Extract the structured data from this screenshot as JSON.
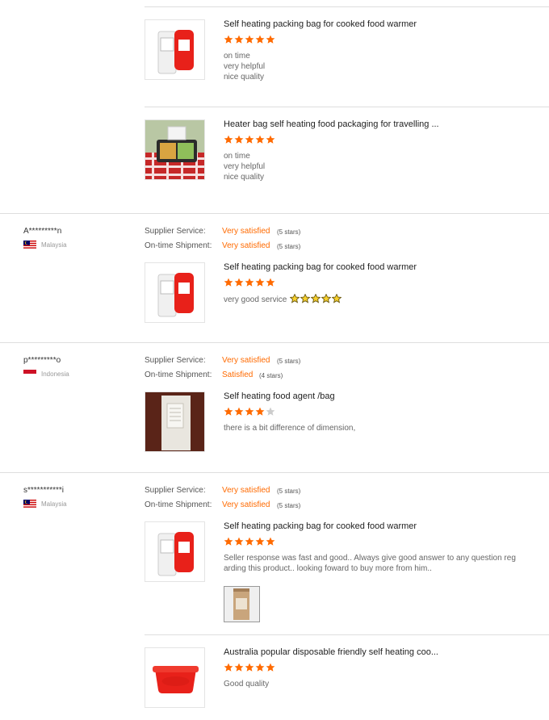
{
  "colors": {
    "star_on": "#ff6a00",
    "star_off": "#cccccc",
    "satisfied": "#ff6a00"
  },
  "labels": {
    "supplier_service": "Supplier Service:",
    "ontime_shipment": "On-time Shipment:"
  },
  "reviews_top": [
    {
      "product": "Self heating packing bag for cooked food warmer",
      "rating": 5,
      "comment_lines": [
        "on time",
        "very helpful",
        "nice quality"
      ],
      "thumb": "red-bag-thumb"
    },
    {
      "product": "Heater bag self heating food packaging for travelling ...",
      "rating": 5,
      "comment_lines": [
        "on time",
        "very helpful",
        "nice quality"
      ],
      "thumb": "picnic-lunchbox-thumb"
    }
  ],
  "buyers": [
    {
      "name": "A*********n",
      "country": "Malaysia",
      "flag": "malaysia",
      "supplier_service": "Very satisfied",
      "supplier_service_stars": "(5 stars)",
      "ontime_shipment": "Very satisfied",
      "ontime_shipment_stars": "(5 stars)",
      "items": [
        {
          "product": "Self heating packing bag for cooked food warmer",
          "rating": 5,
          "comment": "very good service",
          "emoji_stars": 5
        }
      ]
    },
    {
      "name": "p*********o",
      "country": "Indonesia",
      "flag": "indonesia",
      "supplier_service": "Very satisfied",
      "supplier_service_stars": "(5 stars)",
      "ontime_shipment": "Satisfied",
      "ontime_shipment_stars": "(4 stars)",
      "items": [
        {
          "product": "Self heating food agent /bag",
          "rating": 4,
          "comment": "there is a bit difference of dimension,"
        }
      ]
    },
    {
      "name": "s***********i",
      "country": "Malaysia",
      "flag": "malaysia",
      "supplier_service": "Very satisfied",
      "supplier_service_stars": "(5 stars)",
      "ontime_shipment": "Very satisfied",
      "ontime_shipment_stars": "(5 stars)",
      "items": [
        {
          "product": "Self heating packing bag for cooked food warmer",
          "rating": 5,
          "comment_lines": [
            "Seller response was fast and good.. Always give good answer to any question reg",
            "arding this product.. looking foward to buy more from him.."
          ],
          "attachment": "kraft-bag-photo"
        },
        {
          "product": "Australia popular disposable friendly self heating coo...",
          "rating": 5,
          "comment": "Good quality",
          "thumb": "red-box-thumb"
        }
      ]
    }
  ]
}
